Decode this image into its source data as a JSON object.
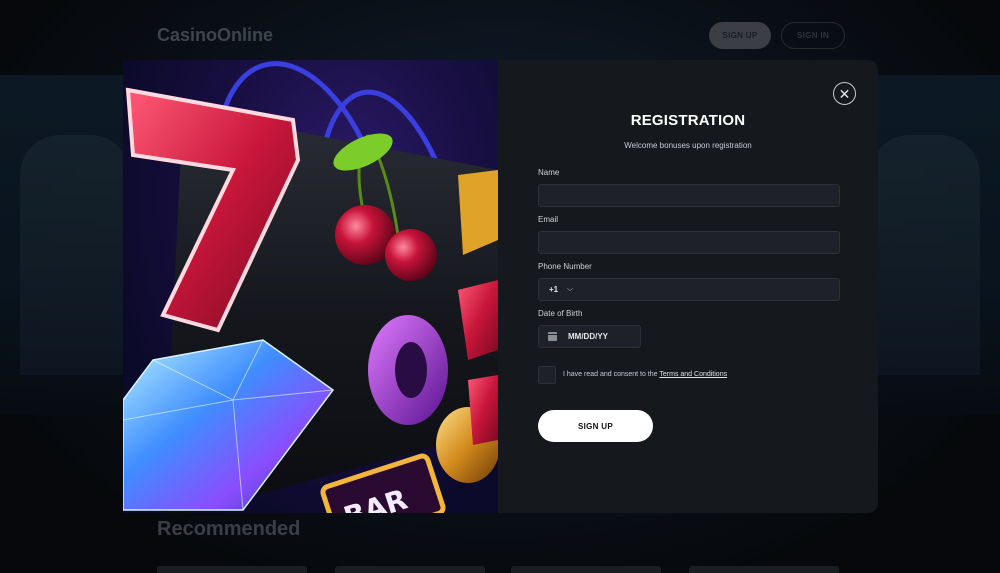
{
  "site": {
    "logo": "CasinoOnline"
  },
  "header": {
    "signup_label": "SIGN UP",
    "signin_label": "SIGN IN"
  },
  "sections": {
    "recommended": "Recommended"
  },
  "modal": {
    "title": "REGISTRATION",
    "subtitle": "Welcome bonuses upon registration",
    "close_icon": "close-icon",
    "fields": {
      "name_label": "Name",
      "email_label": "Email",
      "phone_label": "Phone Number",
      "phone_code": "+1",
      "dob_label": "Date of Birth",
      "dob_placeholder": "MM/DD/YY"
    },
    "consent_prefix": "I have read and consent to the ",
    "consent_link": "Terms and Conditions",
    "submit_label": "SIGN UP"
  },
  "colors": {
    "modal_bg": "#15181d",
    "input_bg": "#1e2127",
    "button_bg": "#ffffff",
    "accent_red": "#c21a3a"
  }
}
